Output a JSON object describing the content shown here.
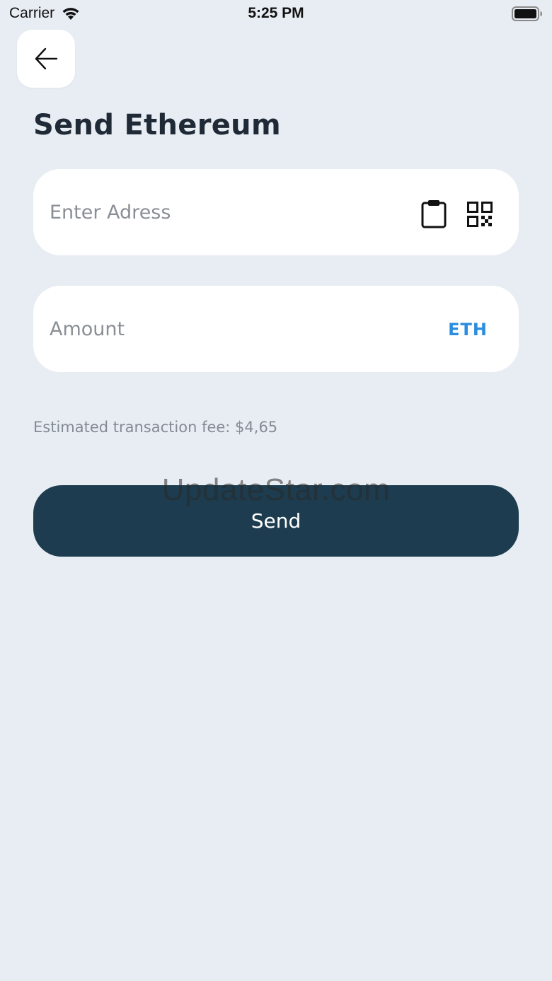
{
  "status_bar": {
    "carrier": "Carrier",
    "time": "5:25 PM",
    "icons": [
      "wifi-icon",
      "battery-icon"
    ]
  },
  "header": {
    "back_icon": "arrow-left-icon",
    "title": "Send Ethereum"
  },
  "address_field": {
    "placeholder": "Enter Adress",
    "value": "",
    "icons": [
      "clipboard-paste-icon",
      "qr-code-icon"
    ]
  },
  "amount_field": {
    "placeholder": "Amount",
    "value": "",
    "currency": "ETH"
  },
  "fee": {
    "text": "Estimated transaction fee: $4,65"
  },
  "send_button": {
    "label": "Send"
  },
  "watermark": {
    "text": "UpdateStar.com"
  },
  "colors": {
    "background": "#e8edf3",
    "card": "#ffffff",
    "primary_button": "#1d3c4f",
    "accent": "#2b8de0",
    "title_text": "#1f2a36",
    "muted_text": "#858b92"
  }
}
